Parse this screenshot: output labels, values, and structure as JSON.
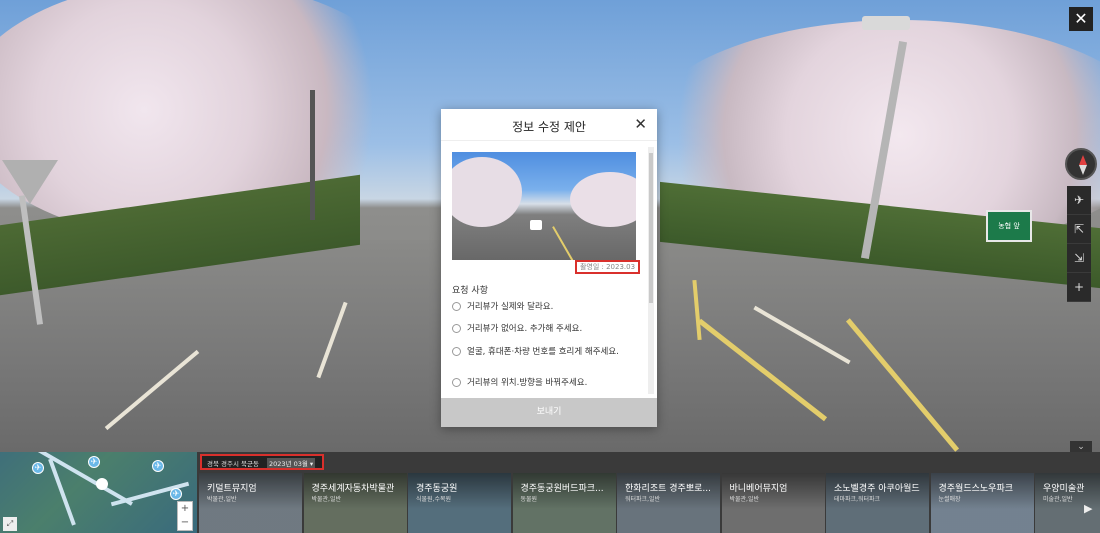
{
  "scene": {
    "close_label": "✕",
    "sign_text": "농협 앞",
    "collapse_label": "⌄"
  },
  "side_tools": [
    "✈",
    "⇱",
    "⇲",
    "+",
    "−"
  ],
  "modal": {
    "title": "정보 수정 제안",
    "close_label": "✕",
    "shot_date": "촬영일 : 2023.03",
    "request_title": "요청 사항",
    "options": [
      "거리뷰가 실제와 달라요.",
      "거리뷰가 없어요. 추가해 주세요.",
      "얼굴, 휴대폰·차량 번호를 흐리게 해주세요.",
      "거리뷰의 위치.방향을 바꿔주세요."
    ],
    "submit_label": "보내기"
  },
  "minimap": {
    "zoom_in": "+",
    "zoom_out": "−",
    "expand": "⤢",
    "pin_labels": [
      "✈",
      "✈",
      "✈",
      "✈",
      "✈"
    ]
  },
  "place": {
    "name": "경북 경주시 북군동",
    "date": "2023년 03월 ▾"
  },
  "cards": [
    {
      "name": "키덜트뮤지엄",
      "category": "박물관,일반",
      "color": "#7c8790"
    },
    {
      "name": "경주세계자동차박물관",
      "category": "박물관,일반",
      "color": "#6f7b6a"
    },
    {
      "name": "경주동궁원",
      "category": "식물원,수목원",
      "color": "#5e7a8a"
    },
    {
      "name": "경주동궁원버드파크...",
      "category": "동물원",
      "color": "#6d7f70"
    },
    {
      "name": "한화리조트 경주뽀로...",
      "category": "워터파크,일반",
      "color": "#74808a"
    },
    {
      "name": "바니베어뮤지엄",
      "category": "박물관,일반",
      "color": "#7a7a7a"
    },
    {
      "name": "소노벨경주 아쿠아월드",
      "category": "테마파크,워터파크",
      "color": "#6a7a86"
    },
    {
      "name": "경주월드스노우파크",
      "category": "눈썰매장",
      "color": "#8090a0"
    },
    {
      "name": "우양미술관",
      "category": "미술관,일반",
      "color": "#6f7b80"
    }
  ],
  "next_label": "▶"
}
